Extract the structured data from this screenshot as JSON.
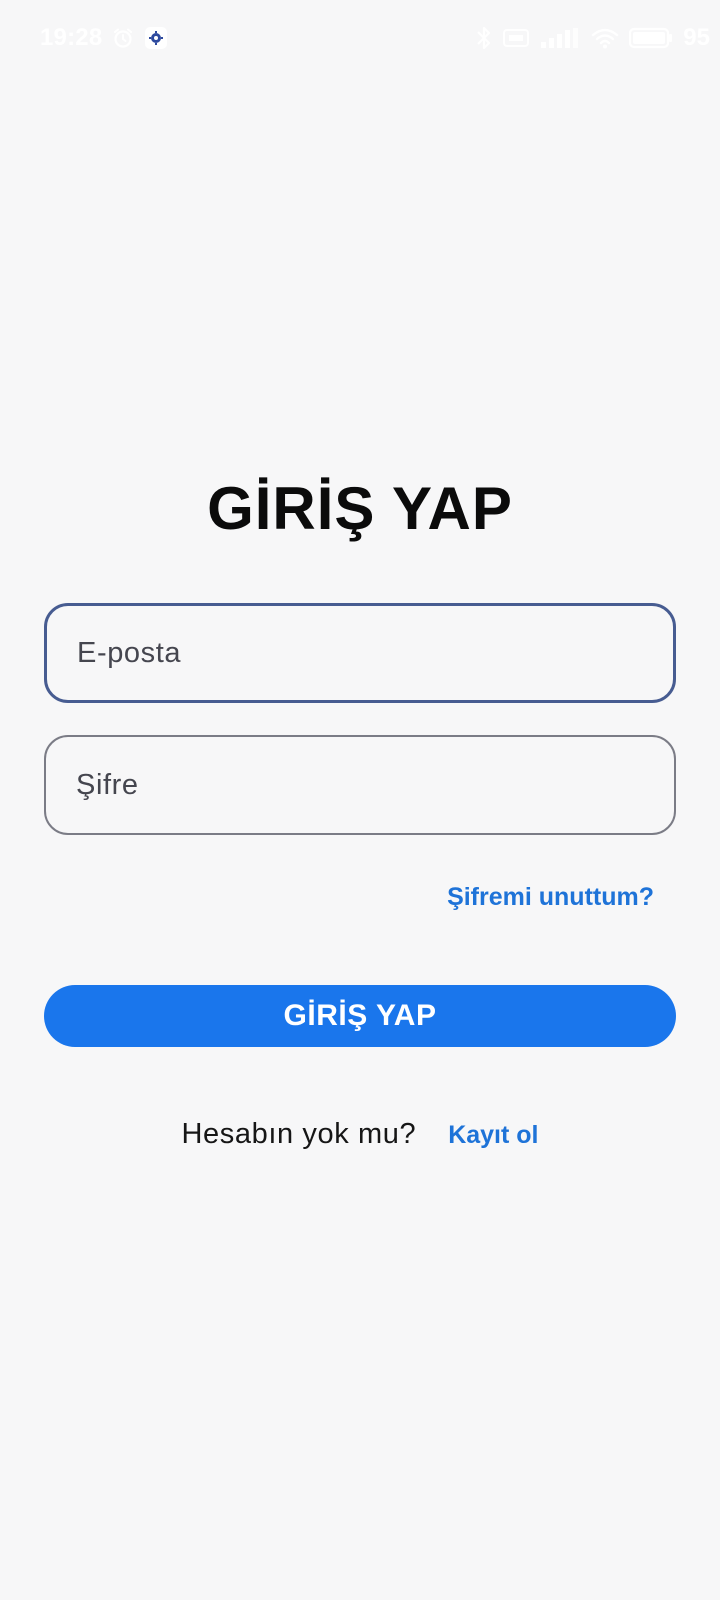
{
  "status_bar": {
    "time": "19:28",
    "battery": "95",
    "icons": [
      "alarm-icon",
      "app-notification-icon",
      "bluetooth-icon",
      "vpn-icon",
      "signal-icon",
      "wifi-icon",
      "battery-icon"
    ]
  },
  "login": {
    "title": "GİRİŞ YAP",
    "email_placeholder": "E-posta",
    "password_placeholder": "Şifre",
    "forgot_label": "Şifremi unuttum?",
    "button_label": "GİRİŞ YAP",
    "register_question": "Hesabın yok mu?",
    "register_link": "Kayıt ol"
  },
  "colors": {
    "background": "#f7f7f8",
    "accent": "#1a76ec",
    "link": "#1e73d8",
    "focused_border": "#475c91",
    "border": "#7b7c86"
  }
}
